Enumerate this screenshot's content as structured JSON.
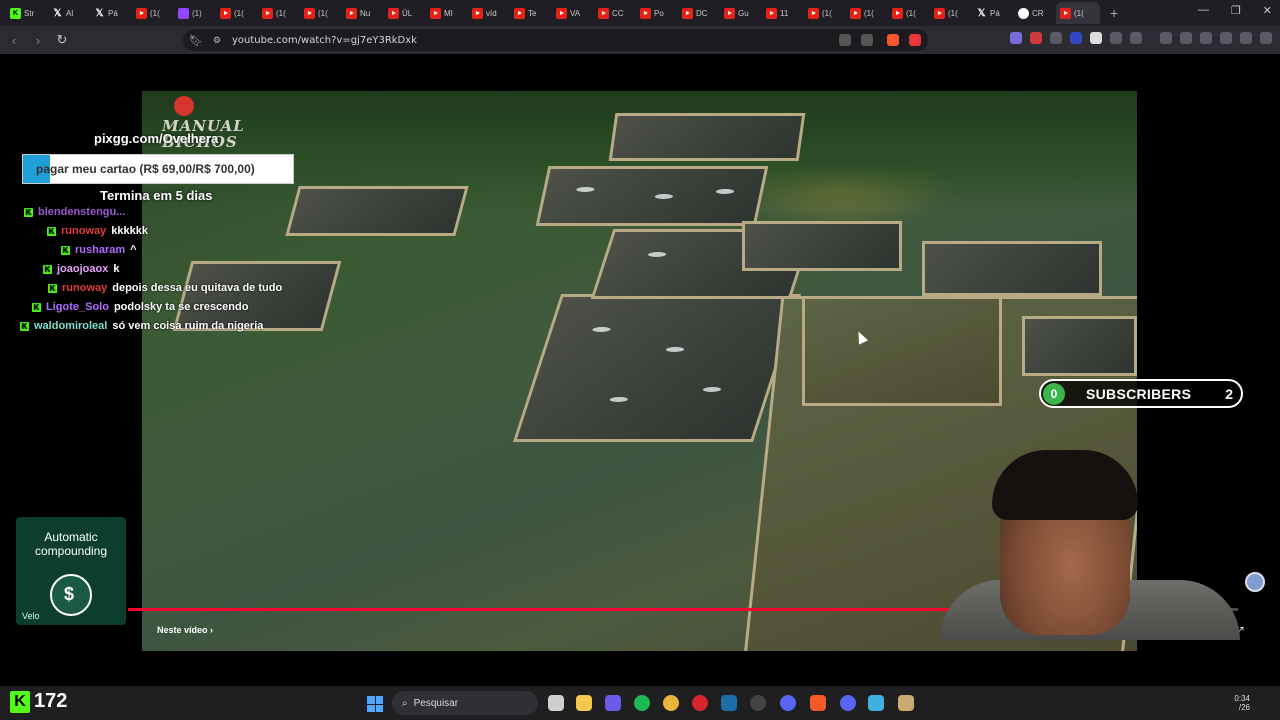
{
  "browser": {
    "tabs": [
      {
        "label": "Str",
        "favicon": "kick-icon"
      },
      {
        "label": "Al",
        "favicon": "x-icon"
      },
      {
        "label": "Pá",
        "favicon": "x-icon"
      },
      {
        "label": "(1(",
        "favicon": "youtube-icon"
      },
      {
        "label": "(1)",
        "favicon": "twitch-icon"
      },
      {
        "label": "(1(",
        "favicon": "youtube-icon"
      },
      {
        "label": "(1(",
        "favicon": "youtube-icon"
      },
      {
        "label": "(1(",
        "favicon": "youtube-icon"
      },
      {
        "label": "Nu",
        "favicon": "youtube-icon"
      },
      {
        "label": "ÚL",
        "favicon": "youtube-icon"
      },
      {
        "label": "MI",
        "favicon": "youtube-icon"
      },
      {
        "label": "víd",
        "favicon": "youtube-icon"
      },
      {
        "label": "Te",
        "favicon": "youtube-icon"
      },
      {
        "label": "VA",
        "favicon": "youtube-icon"
      },
      {
        "label": "CC",
        "favicon": "youtube-icon"
      },
      {
        "label": "Po",
        "favicon": "youtube-icon"
      },
      {
        "label": "DC",
        "favicon": "youtube-icon"
      },
      {
        "label": "Gu",
        "favicon": "youtube-icon"
      },
      {
        "label": "11",
        "favicon": "youtube-icon"
      },
      {
        "label": "(1(",
        "favicon": "youtube-icon"
      },
      {
        "label": "(1(",
        "favicon": "youtube-icon"
      },
      {
        "label": "(1(",
        "favicon": "youtube-icon"
      },
      {
        "label": "(1(",
        "favicon": "youtube-icon"
      },
      {
        "label": "Pá",
        "favicon": "x-icon"
      },
      {
        "label": "CR",
        "favicon": "google-icon"
      },
      {
        "label": "(1(",
        "favicon": "youtube-icon"
      }
    ],
    "url": "youtube.com/watch?v=gj7eY3RkDxk"
  },
  "video": {
    "channel_logo_text": "MANUAL BICHOS",
    "chapter_label": "Neste vídeo",
    "progress": 0.925
  },
  "overlay": {
    "donation_url": "pixgg.com/Ovelhera",
    "goal_text": "pagar meu cartao (R$ 69,00/R$ 700,00)",
    "goal_progress": 0.0986,
    "goal_ends": "Termina em 5 dias",
    "subs_count": "0",
    "subs_label": "SUBSCRIBERS",
    "subs_goal": "2",
    "chat": [
      {
        "user": "blendenstengu...",
        "message": "",
        "color": "#9b59d0"
      },
      {
        "user": "runoway",
        "message": "kkkkkk",
        "color": "#e23b3b"
      },
      {
        "user": "rusharam",
        "message": "^",
        "color": "#b06bff"
      },
      {
        "user": "joaojoaox",
        "message": "k",
        "color": "#e9a0ff"
      },
      {
        "user": "runoway",
        "message": "depois dessa eu quitava de tudo",
        "color": "#e23b3b"
      },
      {
        "user": "Ligote_Solo",
        "message": "podolsky ta se crescendo",
        "color": "#b06bff"
      },
      {
        "user": "waldomiroleal",
        "message": "só vem coisa ruim da nigeria",
        "color": "#7de0d0"
      }
    ],
    "ad": {
      "title": "Automatic compounding",
      "brand": "Velo"
    }
  },
  "taskbar": {
    "viewer_count": "172",
    "search_placeholder": "Pesquisar",
    "time": "0:34",
    "date": "/26"
  }
}
